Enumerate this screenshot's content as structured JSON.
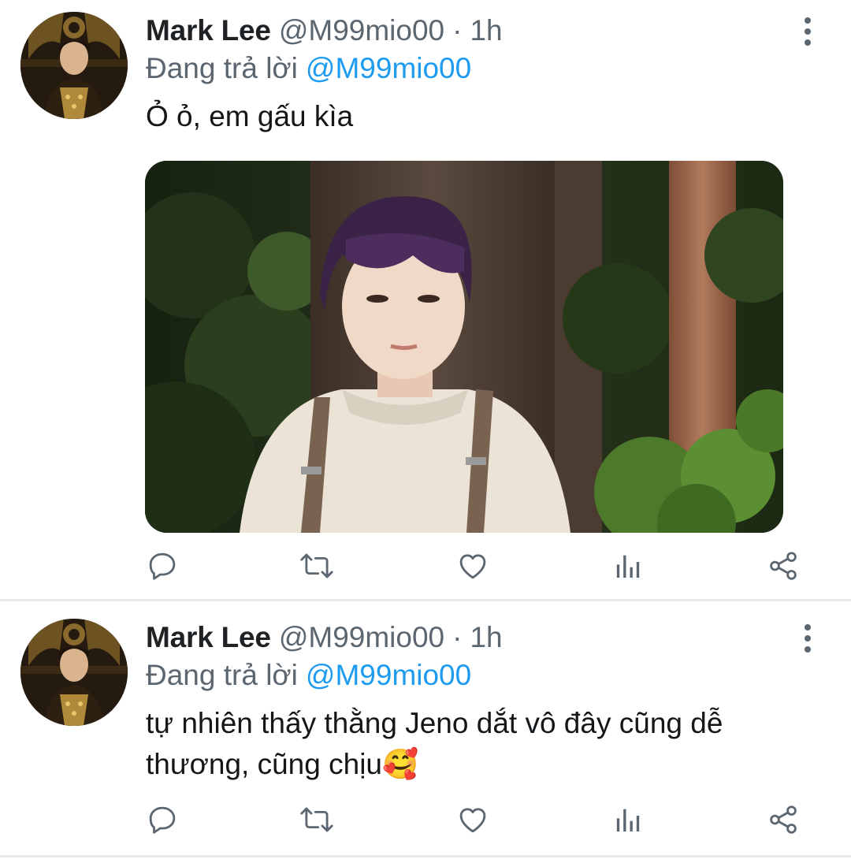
{
  "tweets": [
    {
      "author_name": "Mark Lee",
      "handle": "@M99mio00",
      "separator": "·",
      "time": "1h",
      "replying_label": "Đang trả lời",
      "replying_to": "@M99mio00",
      "text": "Ỏ ỏ, em gấu kìa",
      "has_media": true,
      "media_icon": "photo-of-person-in-forest"
    },
    {
      "author_name": "Mark Lee",
      "handle": "@M99mio00",
      "separator": "·",
      "time": "1h",
      "replying_label": "Đang trả lời",
      "replying_to": "@M99mio00",
      "text": "tự nhiên thấy thằng Jeno dắt vô đây cũng dễ thương, cũng chịu🥰",
      "has_media": false
    }
  ],
  "actions": [
    "reply-icon",
    "retweet-icon",
    "like-icon",
    "analytics-icon",
    "share-icon"
  ],
  "colors": {
    "text": "#14171a",
    "secondary": "#5b6670",
    "link": "#1d9bf0",
    "divider": "#e6ecf0"
  }
}
